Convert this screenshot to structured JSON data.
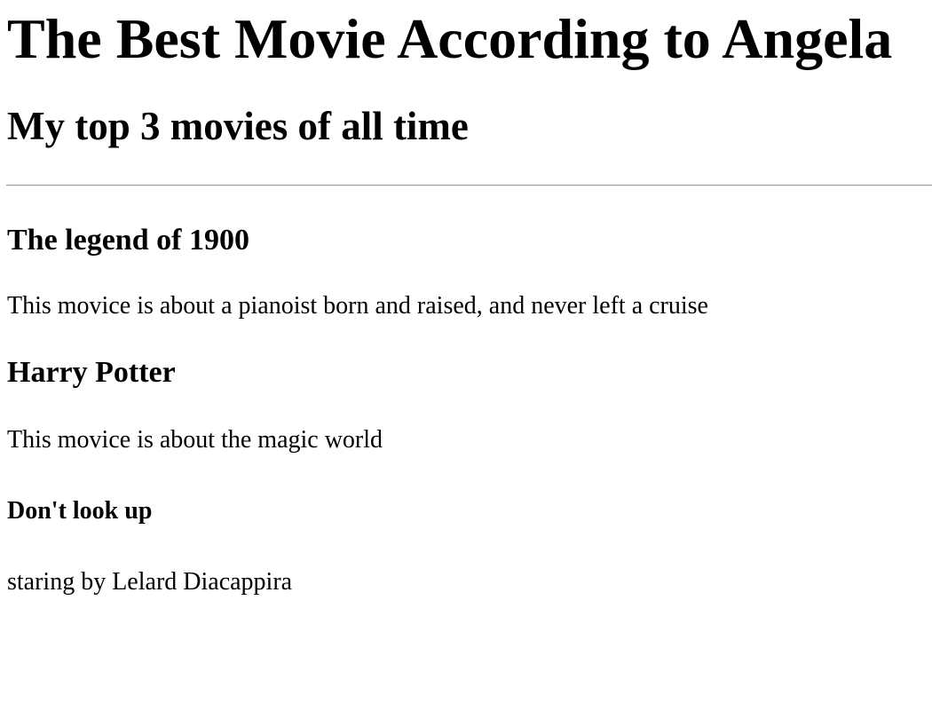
{
  "page": {
    "title": "The Best Movie According to Angela",
    "subtitle": "My top 3 movies of all time"
  },
  "movies": [
    {
      "title": "The legend of 1900",
      "description": "This movice is about a pianoist born and raised, and never left a cruise"
    },
    {
      "title": "Harry Potter",
      "description": "This movice is about the magic world"
    },
    {
      "title": "Don't look up",
      "description": "staring by Lelard Diacappira"
    }
  ]
}
